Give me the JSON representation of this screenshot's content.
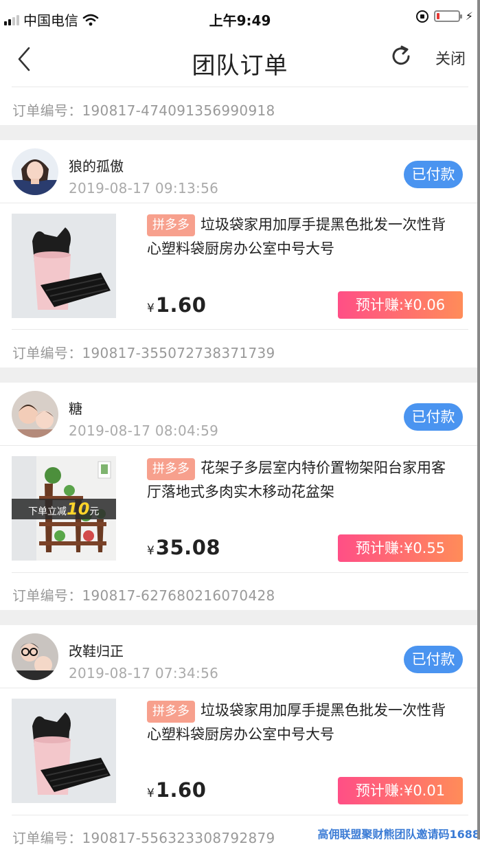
{
  "status_bar": {
    "carrier": "中国电信",
    "time": "上午9:49"
  },
  "nav": {
    "title": "团队订单",
    "close_label": "关闭"
  },
  "top_order": {
    "label": "订单编号：",
    "number": "190817-474091356990918"
  },
  "orders": [
    {
      "user_name": "狼的孤傲",
      "time": "2019-08-17 09:13:56",
      "status": "已付款",
      "platform": "拼多多",
      "title": "垃圾袋家用加厚手提黑色批发一次性背心塑料袋厨房办公室中号大号",
      "title_line1": "垃圾袋家用加厚手提黑色批发一次性背",
      "title_line2": "心塑料袋厨房办公室中号大号",
      "currency": "¥",
      "price": "1.60",
      "earn": "预计赚:¥0.06",
      "order_label": "订单编号：",
      "order_number": "190817-355072738371739"
    },
    {
      "user_name": "糖",
      "time": "2019-08-17 08:04:59",
      "status": "已付款",
      "platform": "拼多多",
      "title": "花架子多层室内特价置物架阳台家用客厅落地式多肉实木移动花盆架",
      "title_line1": "花架子多层室内特价置物架阳台家用客",
      "title_line2": "厅落地式多肉实木移动花盆架",
      "promo_text": "下单立减",
      "promo_num": "10",
      "promo_unit": "元",
      "currency": "¥",
      "price": "35.08",
      "earn": "预计赚:¥0.55",
      "order_label": "订单编号：",
      "order_number": "190817-627680216070428"
    },
    {
      "user_name": "改鞋归正",
      "time": "2019-08-17 07:34:56",
      "status": "已付款",
      "platform": "拼多多",
      "title": "垃圾袋家用加厚手提黑色批发一次性背心塑料袋厨房办公室中号大号",
      "title_line1": "垃圾袋家用加厚手提黑色批发一次性背",
      "title_line2": "心塑料袋厨房办公室中号大号",
      "currency": "¥",
      "price": "1.60",
      "earn": "预计赚:¥0.01",
      "order_label": "订单编号：",
      "order_number": "190817-556323308792879"
    }
  ],
  "watermark": "高佣联盟聚财熊团队邀请码1688",
  "colors": {
    "status_badge": "#4a94f0",
    "platform_tag": "#f7a08d",
    "earn_start": "#ff4f86",
    "earn_end": "#ff8c59",
    "gap": "#efefef"
  },
  "icons": [
    "signal-icon",
    "wifi-icon",
    "lock-rotation-icon",
    "battery-icon",
    "back-arrow-icon",
    "refresh-icon"
  ]
}
